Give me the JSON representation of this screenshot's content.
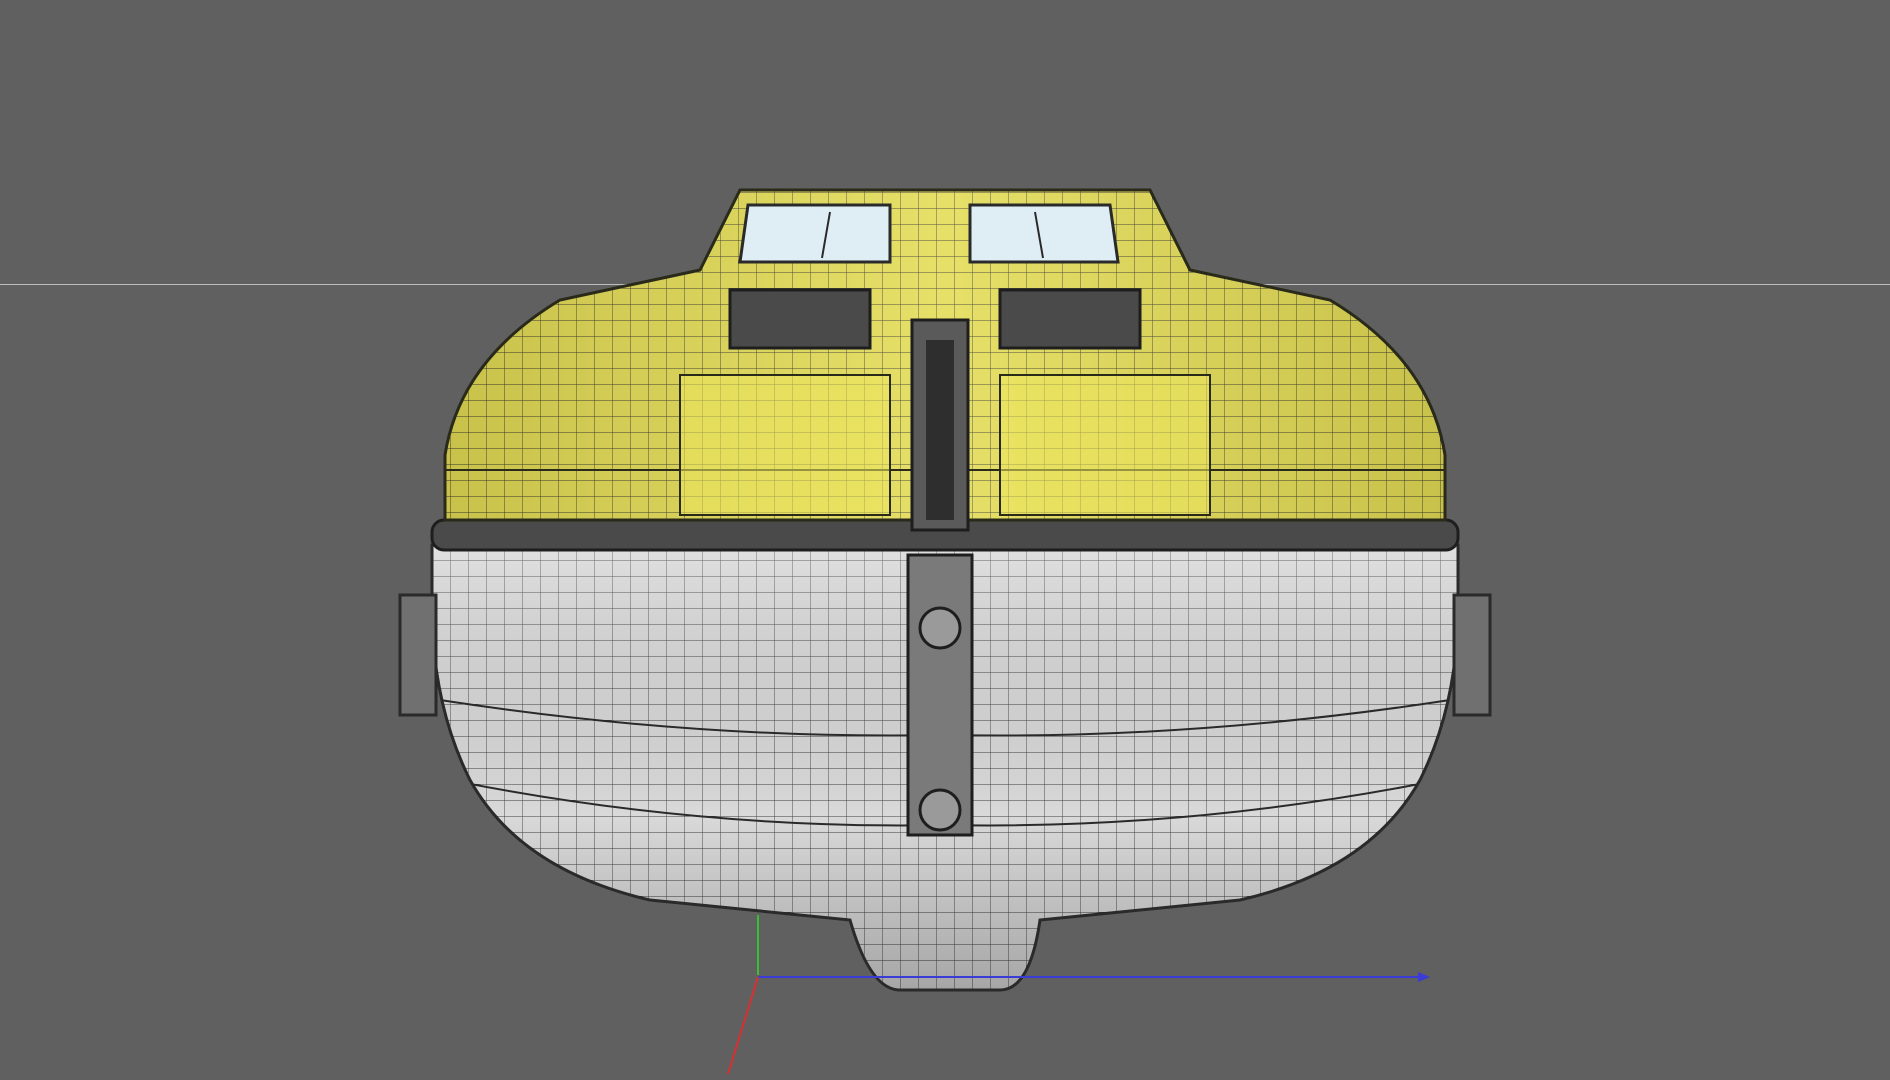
{
  "viewport": {
    "background_color": "#606060",
    "horizon_color": "#bdbdbd"
  },
  "model": {
    "subject": "lifeboat-wireframe",
    "shell_color": "#e6e058",
    "hull_color": "#d8d8d8",
    "wire_color": "#2a2a2a",
    "window_color": "#dfeef5"
  },
  "axes": {
    "x_color": "#3b3bd8",
    "y_color": "#35c035",
    "z_color": "#d83030"
  }
}
